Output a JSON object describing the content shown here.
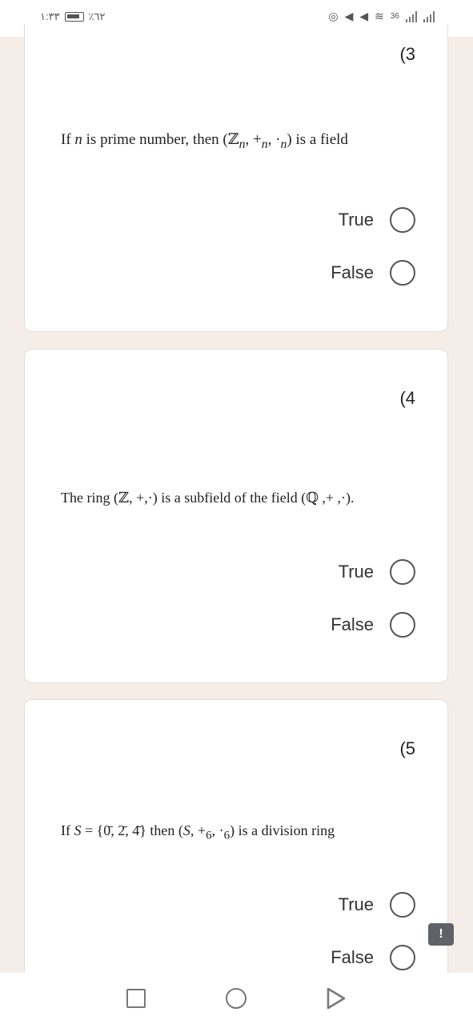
{
  "status_bar": {
    "time": "١:٣٣",
    "battery": "٪٦٢",
    "network": "36"
  },
  "questions": [
    {
      "number": "(3",
      "text_pre": "If ",
      "text_math": "n",
      "text_mid": " is prime number, then ",
      "text_expr": "(ℤ",
      "text_sub": "n",
      "text_expr2": ", +",
      "text_sub2": "n",
      "text_expr3": ", ·",
      "text_sub3": "n",
      "text_post": ") is a field",
      "options": [
        "True",
        "False"
      ]
    },
    {
      "number": "(4",
      "text": "The ring (ℤ, +,·) is a subfield of the field (ℚ ,+ ,·).",
      "options": [
        "True",
        "False"
      ]
    },
    {
      "number": "(5",
      "text_pre": "If ",
      "text_math": "S",
      "text_mid": " = {0̄, 2̄, 4̄} then (",
      "text_math2": "S",
      "text_expr": ", +",
      "text_sub": "6",
      "text_expr2": ", ·",
      "text_sub2": "6",
      "text_post": ") is a division ring",
      "options": [
        "True",
        "False"
      ]
    }
  ],
  "report_badge": "!"
}
